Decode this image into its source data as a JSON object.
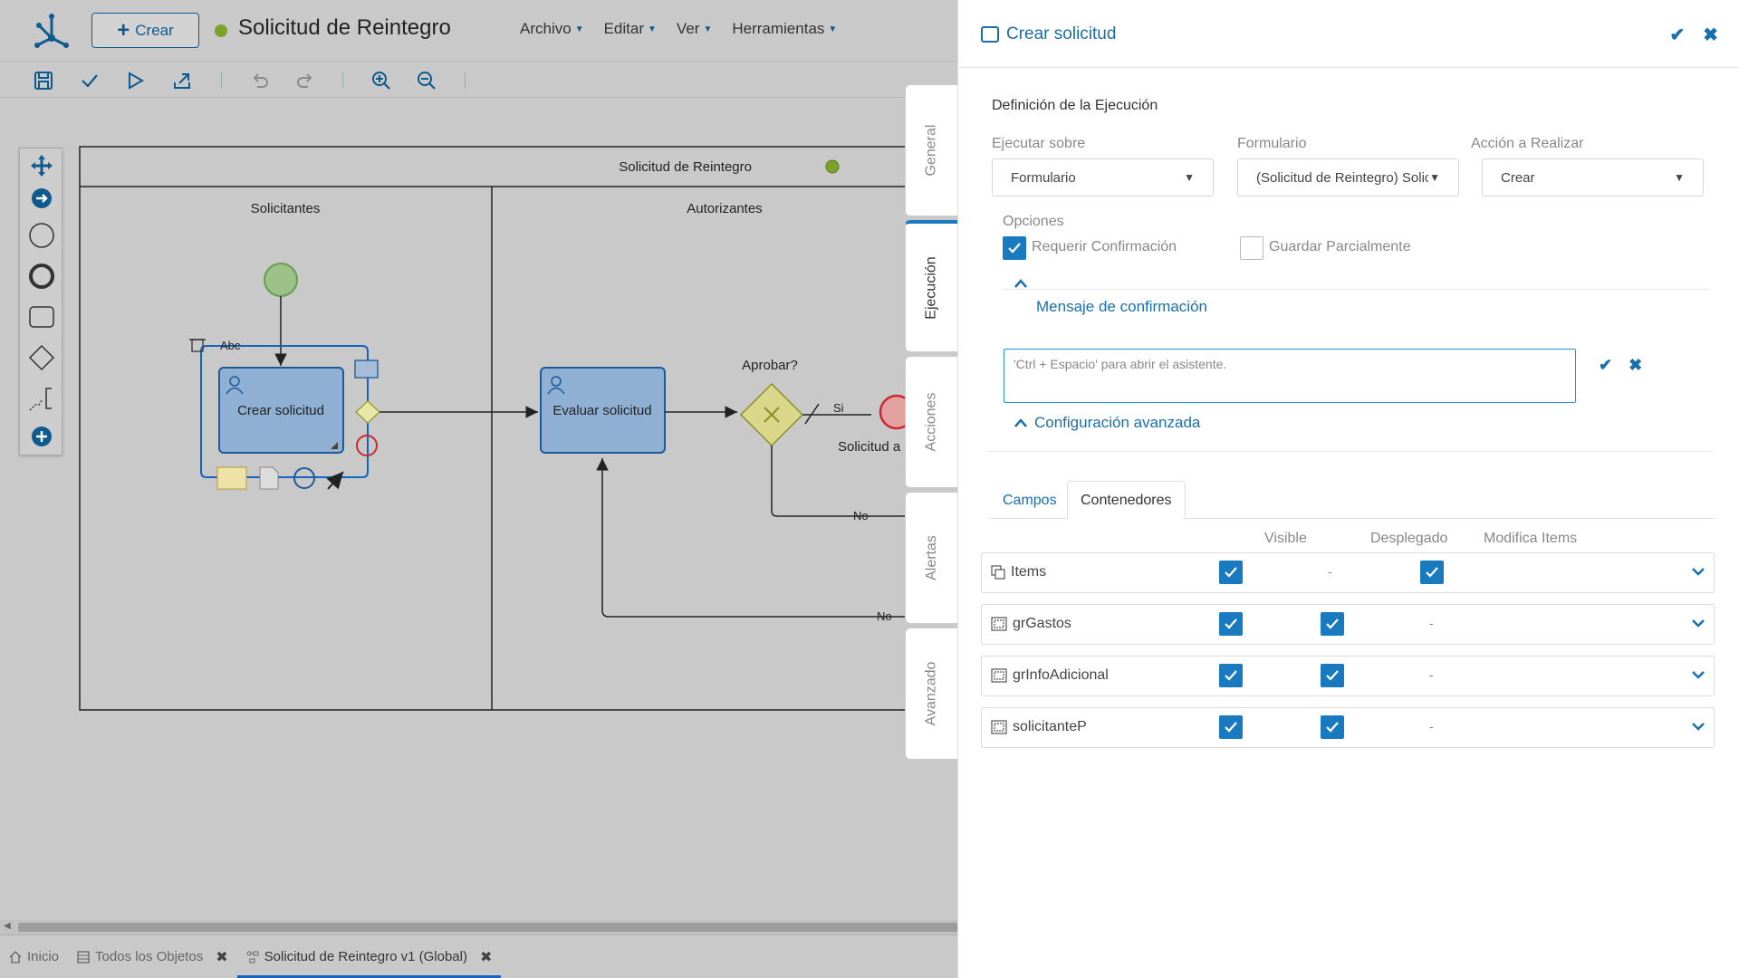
{
  "app": {
    "create_label": "Crear",
    "title": "Solicitud de Reintegro",
    "menu": [
      "Archivo",
      "Editar",
      "Ver",
      "Herramientas"
    ]
  },
  "diagram": {
    "pool_title": "Solicitud de Reintegro",
    "lanes": [
      "Solicitantes",
      "Autorizantes"
    ],
    "task1": "Crear solicitud",
    "task2": "Evaluar solicitud",
    "gateway_label": "Aprobar?",
    "flow_yes": "Si",
    "flow_no1": "No",
    "flow_no2": "No",
    "end_label_partial": "Solicitud a",
    "label_tool": "Abc"
  },
  "bottom_tabs": [
    {
      "label": "Inicio",
      "icon": "home-icon"
    },
    {
      "label": "Todos los Objetos",
      "icon": "list-icon"
    },
    {
      "label": "Solicitud de Reintegro v1 (Global)",
      "icon": "diagram-icon"
    }
  ],
  "vertical_tabs": [
    "General",
    "Ejecución",
    "Acciones",
    "Alertas",
    "Avanzado"
  ],
  "panel": {
    "title": "Crear solicitud",
    "section_title": "Definición de la Ejecución",
    "ejecutar_sobre": {
      "label": "Ejecutar sobre",
      "value": "Formulario"
    },
    "formulario": {
      "label": "Formulario",
      "value": "(Solicitud de Reintegro) Solic"
    },
    "accion": {
      "label": "Acción a Realizar",
      "value": "Crear"
    },
    "opciones_label": "Opciones",
    "requerir_confirmacion": "Requerir Confirmación",
    "guardar_parcialmente": "Guardar Parcialmente",
    "mensaje_confirmacion": "Mensaje de confirmación",
    "textarea_placeholder": "'Ctrl + Espacio' para abrir el asistente.",
    "config_avanzada": "Configuración avanzada",
    "tabs": [
      "Campos",
      "Contenedores"
    ],
    "columns": [
      "Visible",
      "Desplegado",
      "Modifica Items"
    ],
    "rows": [
      {
        "name": "Items",
        "desplegado": "-",
        "modifica": ""
      },
      {
        "name": "grGastos",
        "desplegado": "",
        "modifica": "-"
      },
      {
        "name": "grInfoAdicional",
        "desplegado": "",
        "modifica": "-"
      },
      {
        "name": "solicitanteP",
        "desplegado": "",
        "modifica": "-"
      }
    ]
  },
  "colors": {
    "accent": "#1a7ac0",
    "link": "#1a6fab",
    "status_green": "#7da22b"
  }
}
